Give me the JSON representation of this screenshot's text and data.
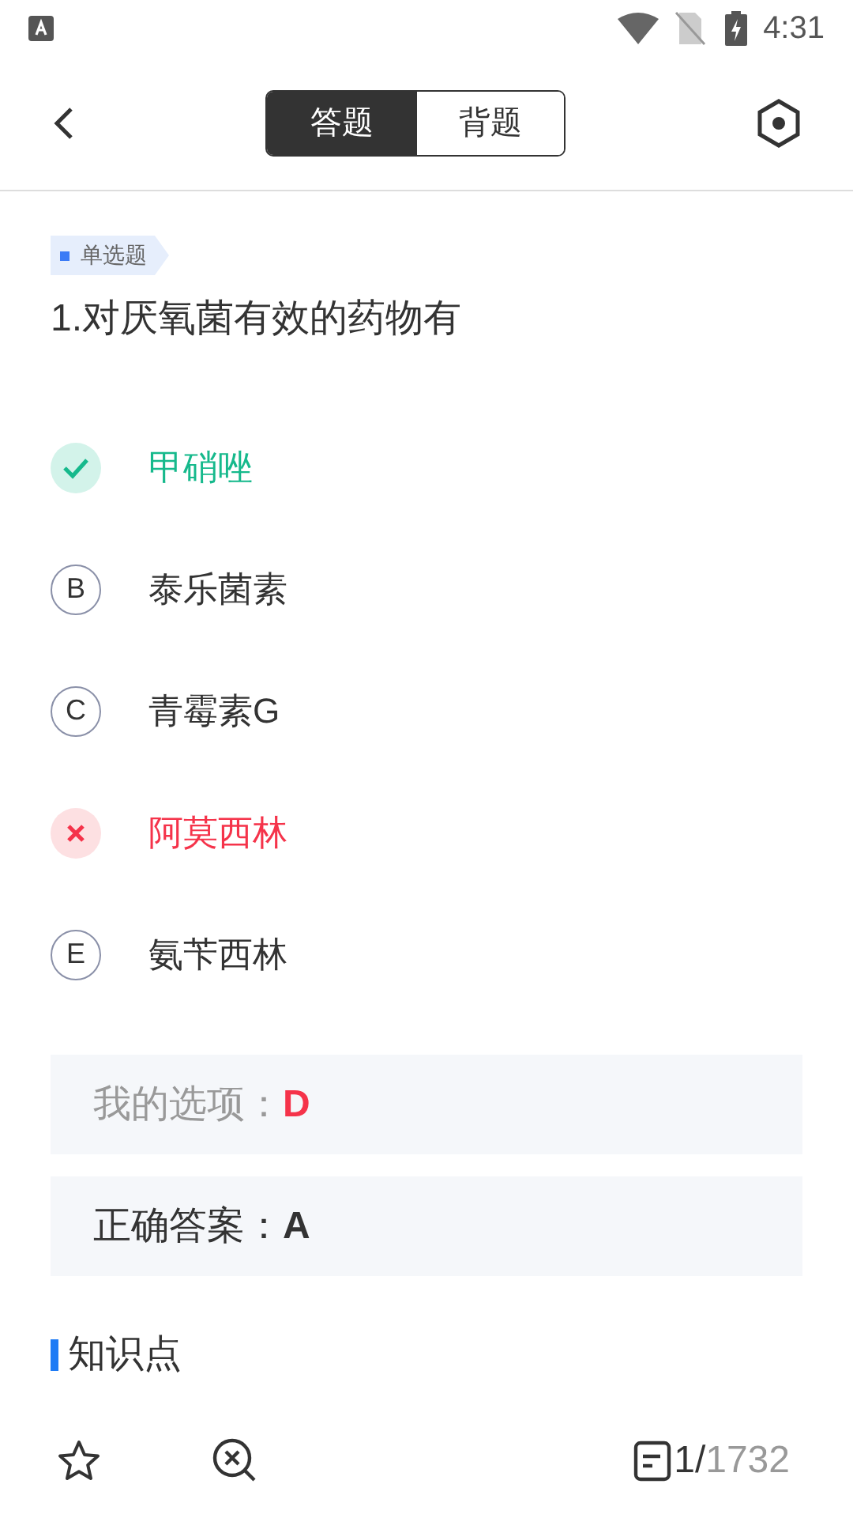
{
  "status_bar": {
    "time": "4:31"
  },
  "header": {
    "tabs": [
      {
        "label": "答题",
        "selected": true
      },
      {
        "label": "背题",
        "selected": false
      }
    ]
  },
  "question": {
    "type_tag": "单选题",
    "text": "1.对厌氧菌有效的药物有",
    "options": [
      {
        "kind": "correct",
        "text": "甲硝唑"
      },
      {
        "kind": "normal",
        "letter": "B",
        "text": "泰乐菌素"
      },
      {
        "kind": "normal",
        "letter": "C",
        "text": "青霉素G"
      },
      {
        "kind": "wrong",
        "text": "阿莫西林"
      },
      {
        "kind": "normal",
        "letter": "E",
        "text": "氨苄西林"
      }
    ]
  },
  "my_answer": {
    "label": "我的选项：",
    "value": "D"
  },
  "correct_answer": {
    "label": "正确答案：",
    "value": "A"
  },
  "knowledge_heading": "知识点",
  "bottom_bar": {
    "current": "1/",
    "total": "1732"
  }
}
